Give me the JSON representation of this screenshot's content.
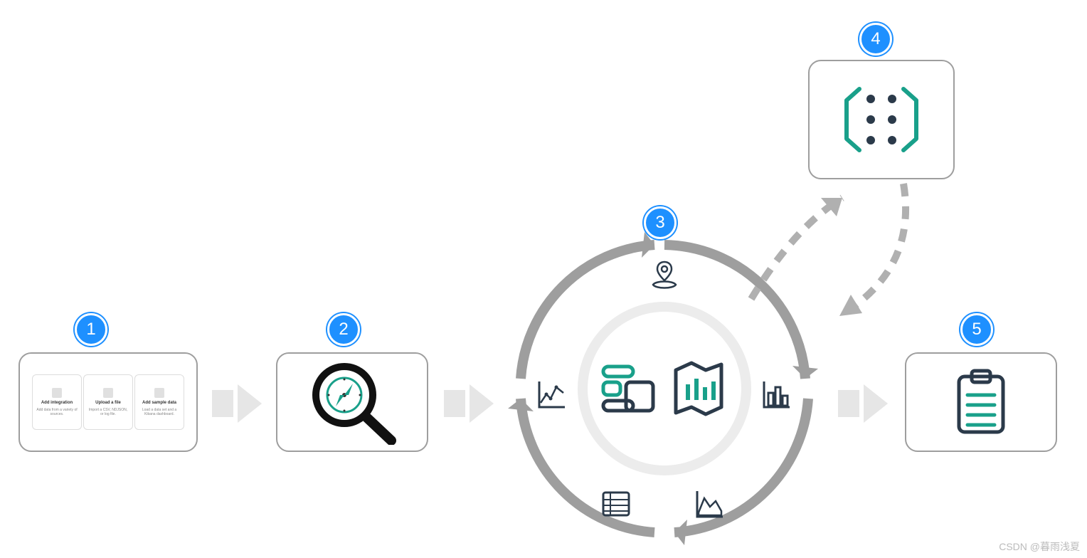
{
  "steps": {
    "s1": {
      "number": "1"
    },
    "s2": {
      "number": "2"
    },
    "s3": {
      "number": "3"
    },
    "s4": {
      "number": "4"
    },
    "s5": {
      "number": "5"
    }
  },
  "step1_cards": [
    {
      "title": "Add integration",
      "desc": "Add data from a variety of sources."
    },
    {
      "title": "Upload a file",
      "desc": "Import a CSV, NDJSON, or log file."
    },
    {
      "title": "Add sample data",
      "desc": "Load a data set and a Kibana dashboard."
    }
  ],
  "footer_watermark": "CSDN @暮雨浅夏"
}
